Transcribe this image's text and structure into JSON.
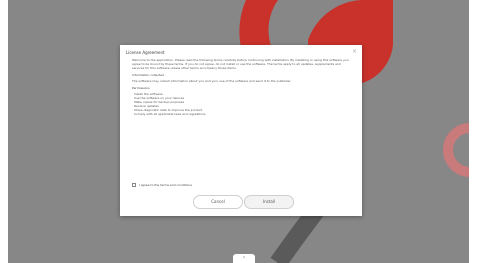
{
  "dialog": {
    "title": "License Agreement",
    "close_glyph": "×",
    "paragraphs": [
      "Welcome to the application. Please read the following terms carefully before continuing with installation. By installing or using this software you agree to be bound by these terms. If you do not agree, do not install or use the software. The terms apply to all updates, supplements and services for this software unless other terms accompany those items.",
      "Information collected"
    ],
    "notice": "The software may collect information about you and your use of the software and send it to the publisher.",
    "section_heading": "Permissions",
    "list_items": [
      "Install the software",
      "Use the software on your devices",
      "Make copies for backup purposes",
      "Receive updates",
      "Share diagnostic data to improve the product",
      "Comply with all applicable laws and regulations"
    ],
    "checkbox_label": "I agree to the terms and conditions",
    "cancel_label": "Cancel",
    "accept_label": "Install"
  },
  "taskbar": {
    "indicator_glyph": "⌃"
  },
  "colors": {
    "backdrop": "#878787",
    "accent_red": "#c8322b",
    "ring_pink": "#c97a7a",
    "stroke_dark": "#5a5a5a"
  }
}
